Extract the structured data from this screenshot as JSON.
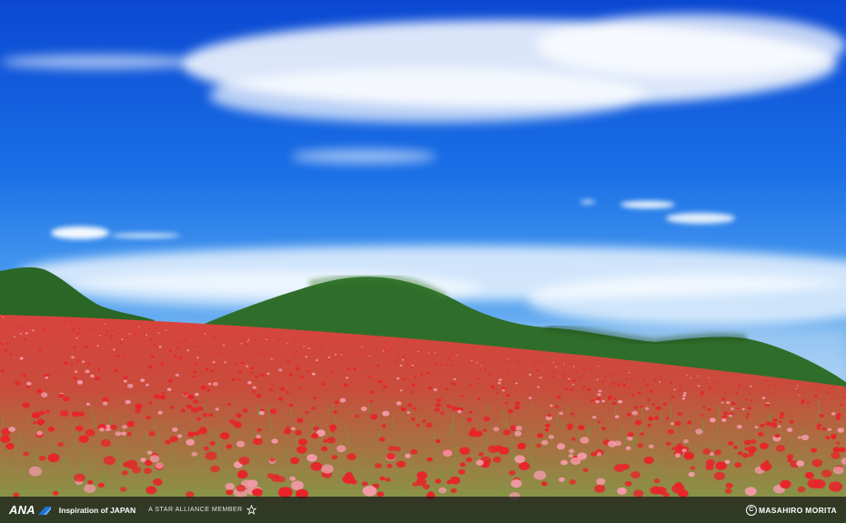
{
  "footer": {
    "brand_logo": "ANA",
    "tagline": "Inspiration of JAPAN",
    "alliance": "A STAR ALLIANCE MEMBER",
    "credit": "MASAHIRO MORITA",
    "copyright_symbol": "C"
  },
  "colors": {
    "sky_top": "#0c4fd6",
    "sky_horizon": "#5aa8f0",
    "hills": "#2f6e2a",
    "field_green": "#7fae52",
    "poppy_red": "#e8232a",
    "poppy_pink": "#f29aa8"
  },
  "icons": {
    "brand_mark": "ana-tail-icon",
    "alliance": "star-alliance-icon",
    "copyright": "copyright-icon"
  }
}
